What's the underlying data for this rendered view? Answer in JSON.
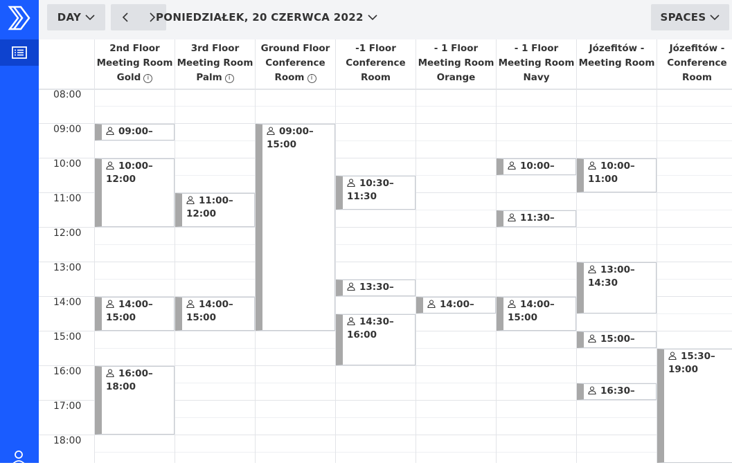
{
  "toolbar": {
    "view_label": "DAY",
    "date_label": "PONIEDZIAŁEK, 20 CZERWCA 2022",
    "spaces_label": "SPACES"
  },
  "time_labels": [
    "08:00",
    "09:00",
    "10:00",
    "11:00",
    "12:00",
    "13:00",
    "14:00",
    "15:00",
    "16:00",
    "17:00",
    "18:00"
  ],
  "columns": [
    {
      "lines": [
        "2nd Floor",
        "Meeting Room",
        "Gold"
      ],
      "info": true
    },
    {
      "lines": [
        "3rd Floor",
        "Meeting Room",
        "Palm"
      ],
      "info": true
    },
    {
      "lines": [
        "Ground Floor",
        "Conference",
        "Room"
      ],
      "info": true
    },
    {
      "lines": [
        "-1 Floor",
        "Conference",
        "Room"
      ],
      "info": false
    },
    {
      "lines": [
        "- 1 Floor",
        "Meeting Room",
        "Orange"
      ],
      "info": false
    },
    {
      "lines": [
        "- 1 Floor",
        "Meeting Room",
        "Navy"
      ],
      "info": false
    },
    {
      "lines": [
        "Józefitów -",
        "Meeting Room"
      ],
      "info": false
    },
    {
      "lines": [
        "Józefitów -",
        "Conference",
        "Room"
      ],
      "info": false
    }
  ],
  "events": [
    {
      "col": 0,
      "start": "09:00",
      "end": "09:30",
      "line1": "09:00–",
      "line2": ""
    },
    {
      "col": 0,
      "start": "10:00",
      "end": "12:00",
      "line1": "10:00–",
      "line2": "12:00"
    },
    {
      "col": 0,
      "start": "14:00",
      "end": "15:00",
      "line1": "14:00–",
      "line2": "15:00"
    },
    {
      "col": 0,
      "start": "16:00",
      "end": "18:00",
      "line1": "16:00–",
      "line2": "18:00"
    },
    {
      "col": 1,
      "start": "11:00",
      "end": "12:00",
      "line1": "11:00–",
      "line2": "12:00"
    },
    {
      "col": 1,
      "start": "14:00",
      "end": "15:00",
      "line1": "14:00–",
      "line2": "15:00"
    },
    {
      "col": 2,
      "start": "09:00",
      "end": "15:00",
      "line1": "09:00–",
      "line2": "15:00"
    },
    {
      "col": 3,
      "start": "10:30",
      "end": "11:30",
      "line1": "10:30–",
      "line2": "11:30"
    },
    {
      "col": 3,
      "start": "13:30",
      "end": "14:00",
      "line1": "13:30–",
      "line2": ""
    },
    {
      "col": 3,
      "start": "14:30",
      "end": "16:00",
      "line1": "14:30–",
      "line2": "16:00"
    },
    {
      "col": 4,
      "start": "14:00",
      "end": "14:30",
      "line1": "14:00–",
      "line2": ""
    },
    {
      "col": 5,
      "start": "10:00",
      "end": "10:30",
      "line1": "10:00–",
      "line2": ""
    },
    {
      "col": 5,
      "start": "11:30",
      "end": "12:00",
      "line1": "11:30–",
      "line2": ""
    },
    {
      "col": 5,
      "start": "14:00",
      "end": "15:00",
      "line1": "14:00–",
      "line2": "15:00"
    },
    {
      "col": 6,
      "start": "10:00",
      "end": "11:00",
      "line1": "10:00–",
      "line2": "11:00"
    },
    {
      "col": 6,
      "start": "13:00",
      "end": "14:30",
      "line1": "13:00–",
      "line2": "14:30"
    },
    {
      "col": 6,
      "start": "15:00",
      "end": "15:30",
      "line1": "15:00–",
      "line2": ""
    },
    {
      "col": 6,
      "start": "16:30",
      "end": "17:00",
      "line1": "16:30–",
      "line2": ""
    },
    {
      "col": 7,
      "start": "15:30",
      "end": "19:00",
      "line1": "15:30–",
      "line2": "19:00"
    }
  ],
  "colors": {
    "sidebar": "#1a5cff",
    "sidebar_active": "#0e43cf",
    "event_bar": "#a8a8a8",
    "topbar": "#f3f4f6"
  },
  "icons": {
    "logo": "brand-logo-icon",
    "nav": "list-icon",
    "user": "user-icon",
    "event": "person-icon"
  }
}
